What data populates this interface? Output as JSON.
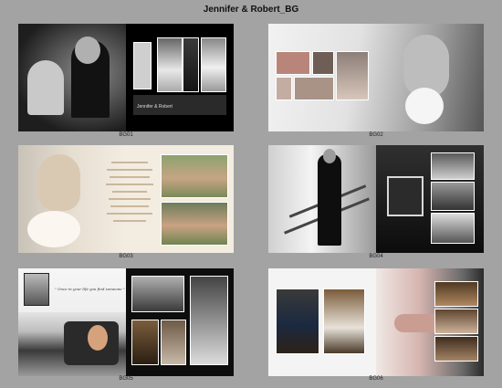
{
  "page": {
    "title": "Jennifer & Robert_BG"
  },
  "spreads": [
    {
      "caption": "BG01"
    },
    {
      "caption": "BG02"
    },
    {
      "caption": "BG03"
    },
    {
      "caption": "BG04"
    },
    {
      "caption": "BG05"
    },
    {
      "caption": "BG06"
    }
  ],
  "bg01": {
    "nameplate": "Jennifer & Robert"
  },
  "bg05": {
    "quote": "\" Once in your life you find someone \""
  }
}
